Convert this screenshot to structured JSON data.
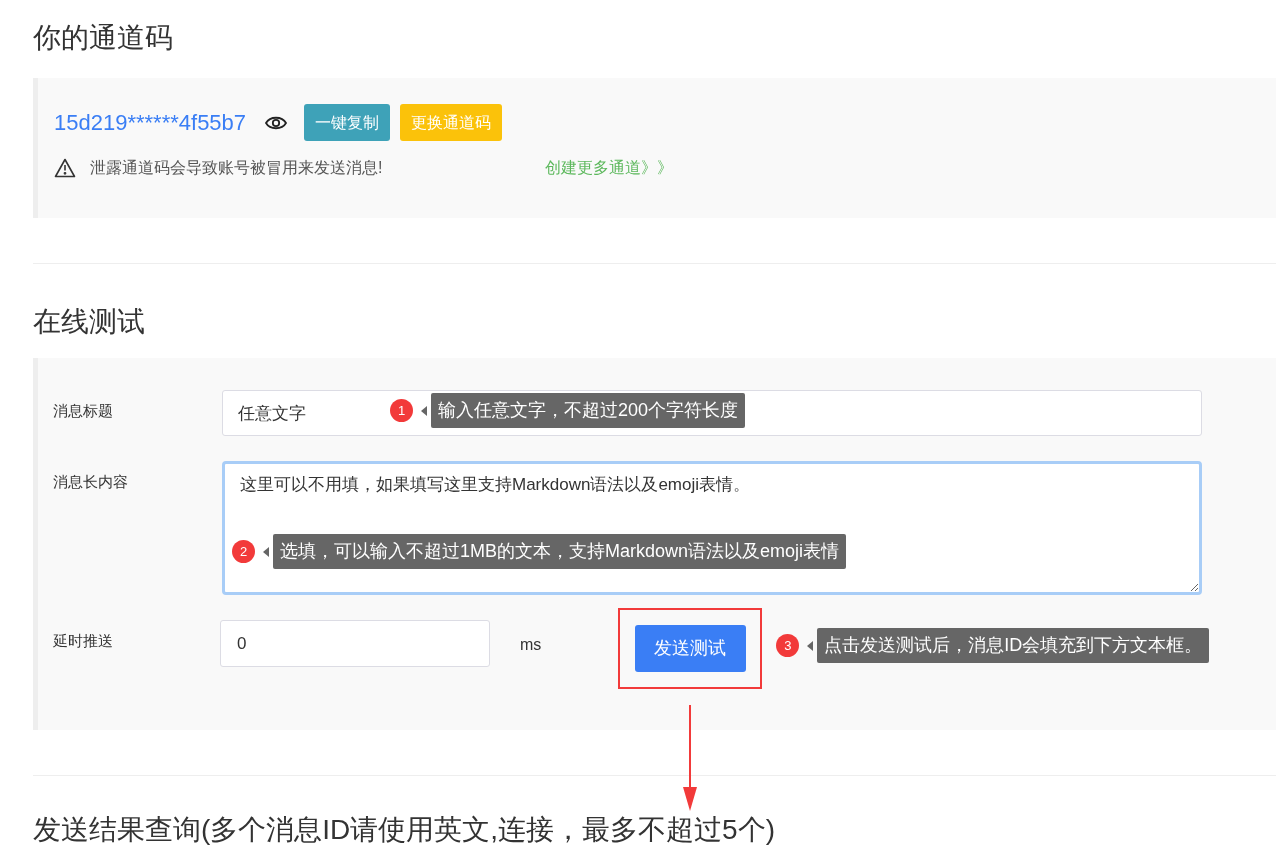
{
  "channel": {
    "title": "你的通道码",
    "code": "15d219******4f55b7",
    "copy_button": "一键复制",
    "change_button": "更换通道码",
    "warning": "泄露通道码会导致账号被冒用来发送消息!",
    "more_link": "创建更多通道》》"
  },
  "test": {
    "title": "在线测试",
    "fields": [
      {
        "kind": "input",
        "label": "消息标题",
        "value": "任意文字",
        "focused": false,
        "note": {
          "number": "1",
          "text": "输入任意文字，不超过200个字符长度"
        }
      },
      {
        "kind": "textarea",
        "label": "消息长内容",
        "value": "这里可以不用填，如果填写这里支持Markdown语法以及emoji表情。",
        "focused": true,
        "note": {
          "number": "2",
          "text": "选填，可以输入不超过1MB的文本，支持Markdown语法以及emoji表情"
        }
      }
    ],
    "delay": {
      "label": "延时推送",
      "value": "0",
      "unit": "ms"
    },
    "send_button": "发送测试",
    "send_note": {
      "number": "3",
      "text": "点击发送测试后，消息ID会填充到下方文本框。"
    }
  },
  "query": {
    "title": "发送结果查询(多个消息ID请使用英文,连接，最多不超过5个)"
  }
}
